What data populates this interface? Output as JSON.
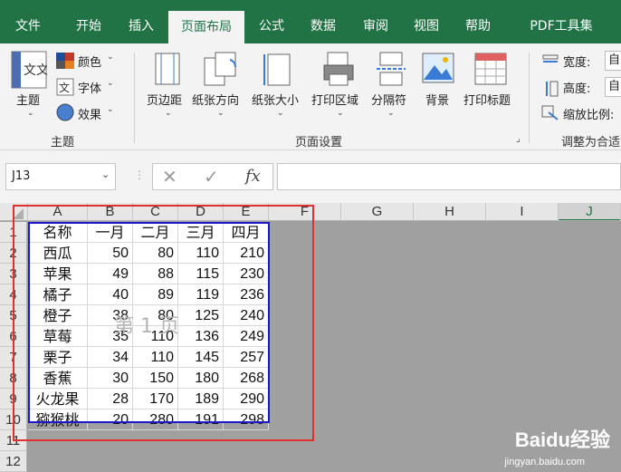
{
  "menu": {
    "tabs": [
      "文件",
      "开始",
      "插入",
      "页面布局",
      "公式",
      "数据",
      "审阅",
      "视图",
      "帮助",
      "PDF工具集"
    ],
    "active": "页面布局"
  },
  "ribbon": {
    "theme_group": {
      "theme_label": "主题",
      "colors_label": "颜色",
      "fonts_label": "字体",
      "effects_label": "效果",
      "group_label": "主题"
    },
    "page_setup": {
      "margins": "页边距",
      "orientation": "纸张方向",
      "size": "纸张大小",
      "print_area": "打印区域",
      "breaks": "分隔符",
      "background": "背景",
      "print_titles": "打印标题",
      "group_label": "页面设置"
    },
    "scale_group": {
      "width_label": "宽度:",
      "height_label": "高度:",
      "scale_label": "缩放比例:",
      "width_value": "自",
      "height_value": "自",
      "group_label": "调整为合适"
    }
  },
  "formula_bar": {
    "name_box": "J13",
    "fx_label": "fx"
  },
  "sheet": {
    "columns": [
      "A",
      "B",
      "C",
      "D",
      "E",
      "F",
      "G",
      "H",
      "I",
      "J"
    ],
    "rows": [
      "1",
      "2",
      "3",
      "4",
      "5",
      "6",
      "7",
      "8",
      "9",
      "10",
      "11",
      "12"
    ],
    "headers": [
      "名称",
      "一月",
      "二月",
      "三月",
      "四月"
    ],
    "data": [
      [
        "西瓜",
        "50",
        "80",
        "110",
        "210"
      ],
      [
        "苹果",
        "49",
        "88",
        "115",
        "230"
      ],
      [
        "橘子",
        "40",
        "89",
        "119",
        "236"
      ],
      [
        "橙子",
        "38",
        "80",
        "125",
        "240"
      ],
      [
        "草莓",
        "35",
        "110",
        "136",
        "249"
      ],
      [
        "栗子",
        "34",
        "110",
        "145",
        "257"
      ],
      [
        "香蕉",
        "30",
        "150",
        "180",
        "268"
      ],
      [
        "火龙果",
        "28",
        "170",
        "189",
        "290"
      ],
      [
        "猕猴桃",
        "20",
        "280",
        "191",
        "298"
      ]
    ],
    "watermark": "第 1 页"
  },
  "overlay": {
    "baidu_logo": "Baidu经验",
    "baidu_url": "jingyan.baidu.com"
  },
  "colors": {
    "accent": "#217346",
    "print_border": "#1a1acc",
    "highlight_box": "#e03030"
  }
}
